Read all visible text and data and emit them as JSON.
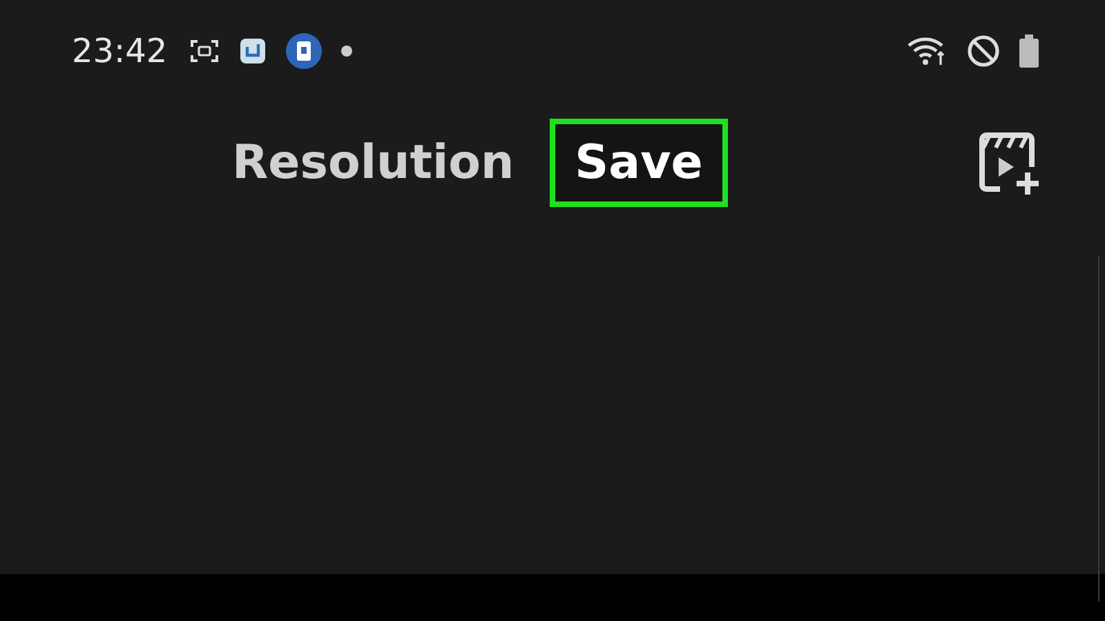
{
  "status_bar": {
    "time": "23:42"
  },
  "toolbar": {
    "actions": [
      {
        "kind": "text",
        "label": "Resolution",
        "highlighted": false
      },
      {
        "kind": "text",
        "label": "Save",
        "highlighted": true
      },
      {
        "kind": "icon"
      }
    ]
  }
}
